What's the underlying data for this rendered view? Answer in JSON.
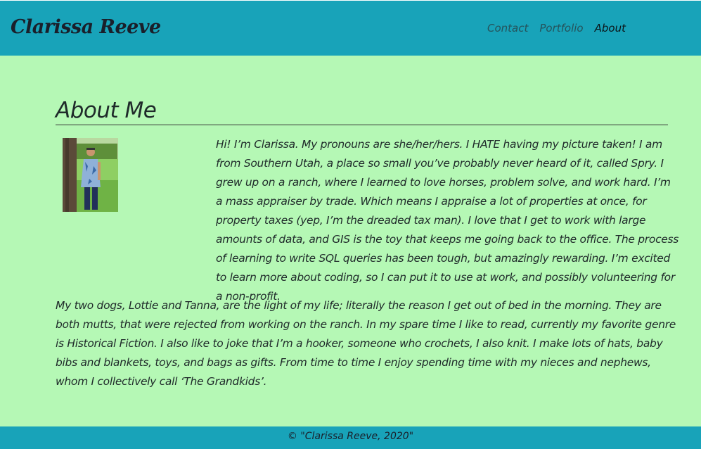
{
  "header": {
    "brand": "Clarissa Reeve",
    "nav": {
      "contact": "Contact",
      "portfolio": "Portfolio",
      "about": "About"
    }
  },
  "main": {
    "heading": "About Me",
    "intro": "Hi! I’m Clarissa. My pronouns are she/her/hers. I HATE having my picture taken! I am from Southern Utah, a place so small you’ve probably never heard of it, called Spry. I grew up on a ranch, where I learned to love horses, problem solve, and work hard. I’m a mass appraiser by trade. Which means I appraise a lot of properties at once, for property taxes (yep, I’m the dreaded tax man). I love that I get to work with large amounts of data, and GIS is the toy that keeps me going back to the office. The process of learning to write SQL queries has been tough, but amazingly rewarding. I’m excited to learn more about coding, so I can put it to use at work, and possibly volunteering for a non-profit.",
    "paragraph2": "My two dogs, Lottie and Tanna, are the light of my life; literally the reason I get out of bed in the morning. They are both mutts, that were rejected from working on the ranch. In my spare time I like to read, currently my favorite genre is Historical Fiction. I also like to joke that I’m a hooker, someone who crochets, I also knit. I make lots of hats, baby bibs and blankets, toys, and bags as gifts. From time to time I enjoy spending time with my nieces and nephews, whom I collectively call ‘The Grandkids’."
  },
  "footer": {
    "copyright": "© \"Clarissa Reeve, 2020\""
  }
}
